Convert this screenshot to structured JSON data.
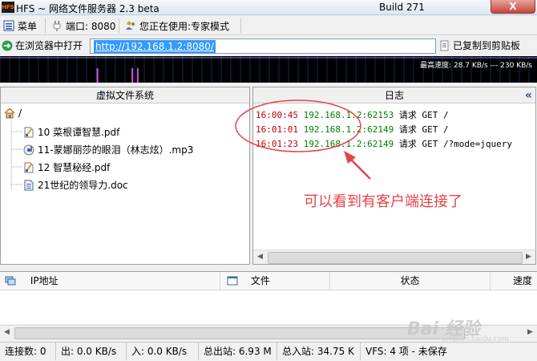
{
  "window": {
    "title": "HFS ~ 网络文件服务器 2.3 beta",
    "build": "Build 271",
    "close_label": "X"
  },
  "toolbar": {
    "menu_label": "菜单",
    "port_label": "端口: 8080",
    "mode_label": "您正在使用:专家模式"
  },
  "urlbar": {
    "open_browser_label": "在浏览器中打开",
    "url": "http://192.168.1.2:8080/",
    "copied_label": "已复制到剪贴板"
  },
  "graph": {
    "speed_label": "最高速度: 28.7 KB/s --- 230 KB/s",
    "spike_positions": [
      0.18,
      0.245,
      0.255
    ]
  },
  "vfs": {
    "header": "虚拟文件系统",
    "root": "/",
    "items": [
      {
        "name": "10 菜根谭智慧.pdf",
        "icon": "pdf-icon"
      },
      {
        "name": "11-蒙娜丽莎的眼泪（林志炫）.mp3",
        "icon": "music-icon"
      },
      {
        "name": "12 智慧秘经.pdf",
        "icon": "pdf-icon"
      },
      {
        "name": "21世纪的领导力.doc",
        "icon": "doc-icon"
      }
    ]
  },
  "log": {
    "header": "日志",
    "collapse_icon": "«",
    "lines": [
      {
        "time": "16:00:45",
        "ip": "192.168.1.2:62153",
        "msg": "请求 GET /"
      },
      {
        "time": "16:01:01",
        "ip": "192.168.1.2:62149",
        "msg": "请求 GET /"
      },
      {
        "time": "16:01:23",
        "ip": "192.168.1.2:62149",
        "msg": "请求 GET /?mode=jquery"
      }
    ]
  },
  "annotation": {
    "text": "可以看到有客户端连接了",
    "color": "#e8434a"
  },
  "connections": {
    "columns": [
      "IP地址",
      "文件",
      "状态",
      "速度"
    ]
  },
  "statusbar": {
    "connections": "连接数: 0",
    "out": "出: 0.0 KB/s",
    "in": "入: 0.0 KB/s",
    "total_out": "总出站: 6.93 M",
    "total_in": "总入站: 34.75 K",
    "vfs": "VFS: 4 项 - 未保存"
  },
  "watermark": {
    "text": "Bai 经验",
    "sub": "jingyan.baidu.com"
  }
}
